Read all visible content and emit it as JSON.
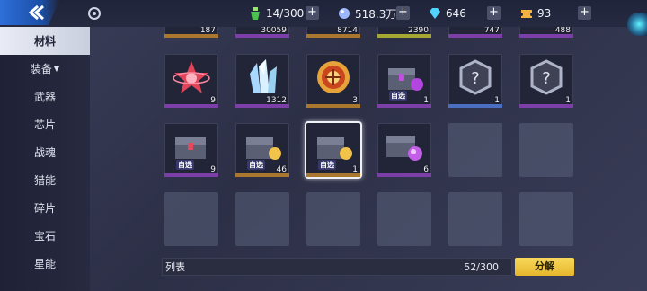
{
  "topbar": {
    "resources": [
      {
        "name": "stamina",
        "icon": "green-potion-icon",
        "value": "14/300",
        "color": "#5cd35c"
      },
      {
        "name": "crystal",
        "icon": "blue-crystal-icon",
        "value": "518.3万",
        "color": "#8fb3ff"
      },
      {
        "name": "diamond",
        "icon": "cyan-diamond-icon",
        "value": "646",
        "color": "#4fd4ff"
      },
      {
        "name": "coupon",
        "icon": "gold-ticket-icon",
        "value": "93",
        "color": "#f2b440"
      }
    ]
  },
  "sidebar": {
    "items": [
      {
        "label": "材料",
        "active": true
      },
      {
        "label": "装备",
        "dropdown": true
      },
      {
        "label": "武器"
      },
      {
        "label": "芯片"
      },
      {
        "label": "战魂"
      },
      {
        "label": "猎能"
      },
      {
        "label": "碎片"
      },
      {
        "label": "宝石"
      },
      {
        "label": "星能"
      }
    ]
  },
  "grid": {
    "partial_row": [
      {
        "count": "187",
        "quality": "#a9772e"
      },
      {
        "count": "30059",
        "quality": "#7c3fa8"
      },
      {
        "count": "8714",
        "quality": "#a9772e"
      },
      {
        "count": "2390",
        "quality": "#a4a832"
      },
      {
        "count": "747",
        "quality": "#7c3fa8"
      },
      {
        "count": "488",
        "quality": "#7c3fa8"
      }
    ],
    "row1": [
      {
        "count": "9",
        "icon": "red-star-emblem-icon",
        "quality": "#7c3fa8"
      },
      {
        "count": "1312",
        "icon": "crystal-cluster-icon",
        "quality": "#7c3fa8"
      },
      {
        "count": "3",
        "icon": "gold-medal-icon",
        "quality": "#a9772e"
      },
      {
        "count": "1",
        "icon": "purple-chest-icon",
        "quality": "#7c3fa8",
        "tag": "自选"
      },
      {
        "count": "1",
        "icon": "mystery-badge-icon",
        "quality": "#4a6fc0"
      },
      {
        "count": "1",
        "icon": "mystery-badge-icon",
        "quality": "#7c3fa8"
      }
    ],
    "row2": [
      {
        "count": "9",
        "icon": "red-chest-icon",
        "quality": "#7c3fa8",
        "tag": "自选"
      },
      {
        "count": "46",
        "icon": "gold-chest-icon",
        "quality": "#a9772e",
        "tag": "自选"
      },
      {
        "count": "1",
        "icon": "gold-chest-icon",
        "quality": "#a9772e",
        "tag": "自选",
        "selected": true
      },
      {
        "count": "6",
        "icon": "purple-gem-chest-icon",
        "quality": "#7c3fa8"
      }
    ]
  },
  "footer": {
    "list_label": "列表",
    "capacity": "52",
    "capacity_max": "/300",
    "decompose_label": "分解"
  }
}
